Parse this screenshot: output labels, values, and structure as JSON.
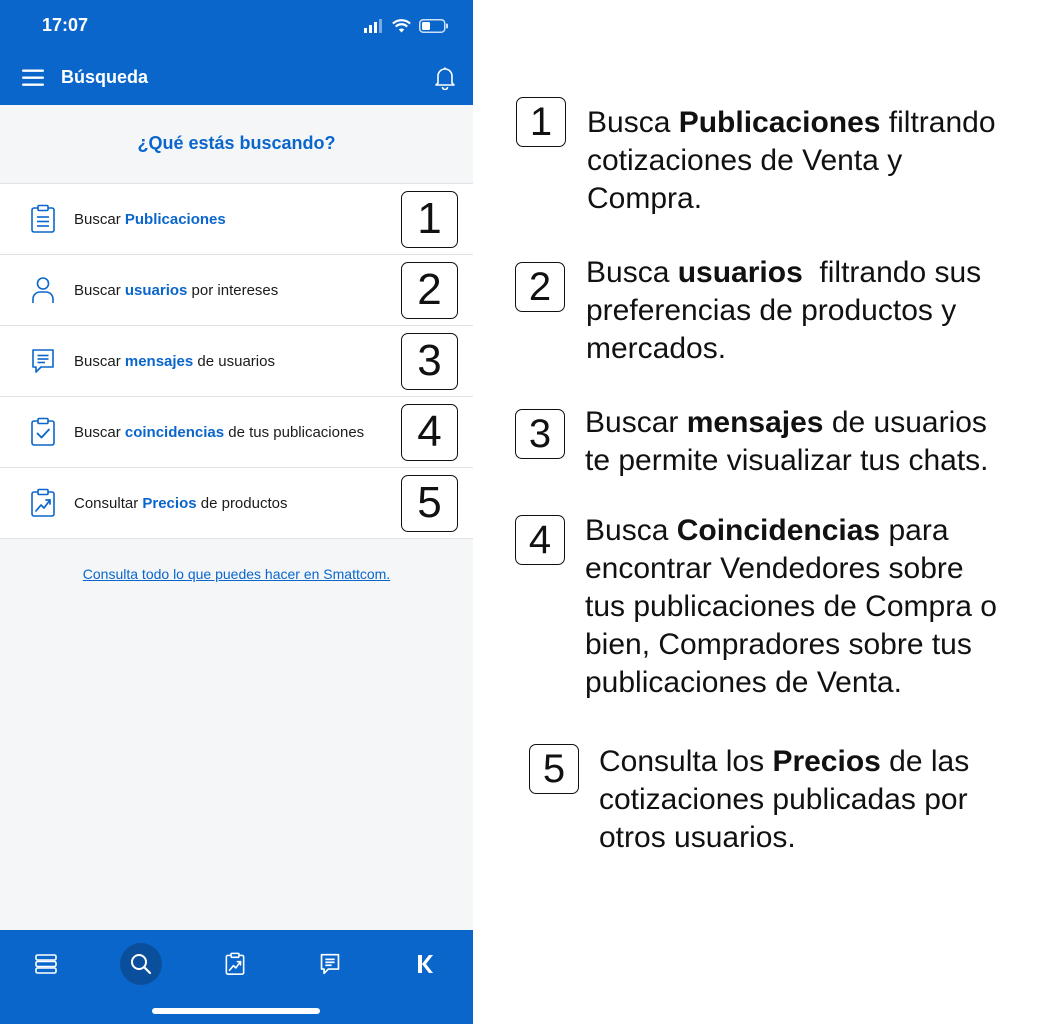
{
  "status": {
    "time": "17:07"
  },
  "appbar": {
    "title": "Búsqueda"
  },
  "question": "¿Qué estás buscando?",
  "menu": [
    {
      "pre": "Buscar ",
      "highlight": "Publicaciones",
      "post": "",
      "number": "1",
      "icon": "clipboard-list-icon"
    },
    {
      "pre": "Buscar ",
      "highlight": "usuarios",
      "post": " por intereses",
      "number": "2",
      "icon": "user-icon"
    },
    {
      "pre": "Buscar ",
      "highlight": "mensajes",
      "post": " de usuarios",
      "number": "3",
      "icon": "message-icon"
    },
    {
      "pre": "Buscar ",
      "highlight": "coincidencias",
      "post": " de tus publicaciones",
      "number": "4",
      "icon": "clipboard-check-icon"
    },
    {
      "pre": "Consultar ",
      "highlight": "Precios",
      "post": " de productos",
      "number": "5",
      "icon": "clipboard-chart-icon"
    }
  ],
  "footer_link": "Consulta todo lo que puedes hacer en Smattcom.",
  "tabs": [
    "list-icon",
    "search-icon",
    "clipboard-chart-icon",
    "message-icon",
    "k-logo-icon"
  ],
  "explanations": [
    {
      "number": "1",
      "parts": [
        "Busca ",
        "Publicaciones",
        " filtrando",
        "cotizaciones de Venta y",
        "Compra."
      ]
    },
    {
      "number": "2",
      "parts": [
        "Busca ",
        "usuarios",
        "  filtrando sus",
        "preferencias de productos y",
        "mercados."
      ]
    },
    {
      "number": "3",
      "parts": [
        "Buscar ",
        "mensajes",
        " de usuarios",
        "te permite visualizar tus chats."
      ]
    },
    {
      "number": "4",
      "parts": [
        "Busca ",
        "Coincidencias",
        " para",
        "encontrar Vendedores sobre",
        "tus publicaciones de Compra o",
        "bien, Compradores sobre tus",
        "publicaciones de Venta."
      ]
    },
    {
      "number": "5",
      "parts": [
        "Consulta los ",
        "Precios",
        " de las",
        "cotizaciones publicadas por",
        "otros usuarios."
      ]
    }
  ],
  "colors": {
    "brand": "#0b66cc",
    "background": "#f4f6f8"
  }
}
